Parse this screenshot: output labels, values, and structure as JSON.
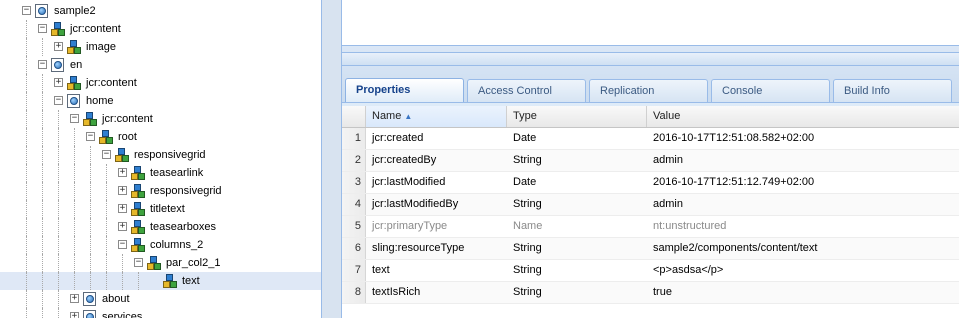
{
  "tree": {
    "nodes": [
      {
        "label": "sample2",
        "icon": "page-icon",
        "toggle": "−"
      },
      {
        "label": "jcr:content",
        "icon": "content-node-icon",
        "toggle": "−"
      },
      {
        "label": "image",
        "icon": "content-node-icon",
        "toggle": "+"
      },
      {
        "label": "en",
        "icon": "page-icon",
        "toggle": "−"
      },
      {
        "label": "jcr:content",
        "icon": "content-node-icon",
        "toggle": "+"
      },
      {
        "label": "home",
        "icon": "page-icon",
        "toggle": "−"
      },
      {
        "label": "jcr:content",
        "icon": "content-node-icon",
        "toggle": "−"
      },
      {
        "label": "root",
        "icon": "content-node-icon",
        "toggle": "−"
      },
      {
        "label": "responsivegrid",
        "icon": "content-node-icon",
        "toggle": "−"
      },
      {
        "label": "teasearlink",
        "icon": "content-node-icon",
        "toggle": "+"
      },
      {
        "label": "responsivegrid",
        "icon": "content-node-icon",
        "toggle": "+"
      },
      {
        "label": "titletext",
        "icon": "content-node-icon",
        "toggle": "+"
      },
      {
        "label": "teasearboxes",
        "icon": "content-node-icon",
        "toggle": "+"
      },
      {
        "label": "columns_2",
        "icon": "content-node-icon",
        "toggle": "−"
      },
      {
        "label": "par_col2_1",
        "icon": "content-node-icon",
        "toggle": "−"
      },
      {
        "label": "text",
        "icon": "content-node-icon",
        "toggle": ""
      },
      {
        "label": "about",
        "icon": "page-icon",
        "toggle": "+"
      },
      {
        "label": "services",
        "icon": "page-icon",
        "toggle": "+"
      }
    ],
    "selected_index": 15
  },
  "tabs": [
    {
      "label": "Properties",
      "active": true
    },
    {
      "label": "Access Control",
      "active": false
    },
    {
      "label": "Replication",
      "active": false
    },
    {
      "label": "Console",
      "active": false
    },
    {
      "label": "Build Info",
      "active": false
    }
  ],
  "grid": {
    "columns": {
      "name": "Name",
      "type": "Type",
      "value": "Value"
    },
    "sort_icon": "sort-ascending-icon",
    "rows": [
      {
        "num": "1",
        "name": "jcr:created",
        "type": "Date",
        "value": "2016-10-17T12:51:08.582+02:00",
        "muted": false
      },
      {
        "num": "2",
        "name": "jcr:createdBy",
        "type": "String",
        "value": "admin",
        "muted": false
      },
      {
        "num": "3",
        "name": "jcr:lastModified",
        "type": "Date",
        "value": "2016-10-17T12:51:12.749+02:00",
        "muted": false
      },
      {
        "num": "4",
        "name": "jcr:lastModifiedBy",
        "type": "String",
        "value": "admin",
        "muted": false
      },
      {
        "num": "5",
        "name": "jcr:primaryType",
        "type": "Name",
        "value": "nt:unstructured",
        "muted": true
      },
      {
        "num": "6",
        "name": "sling:resourceType",
        "type": "String",
        "value": "sample2/components/content/text",
        "muted": false
      },
      {
        "num": "7",
        "name": "text",
        "type": "String",
        "value": "<p>asdsa</p>",
        "muted": false
      },
      {
        "num": "8",
        "name": "textIsRich",
        "type": "String",
        "value": "true",
        "muted": false
      }
    ]
  }
}
